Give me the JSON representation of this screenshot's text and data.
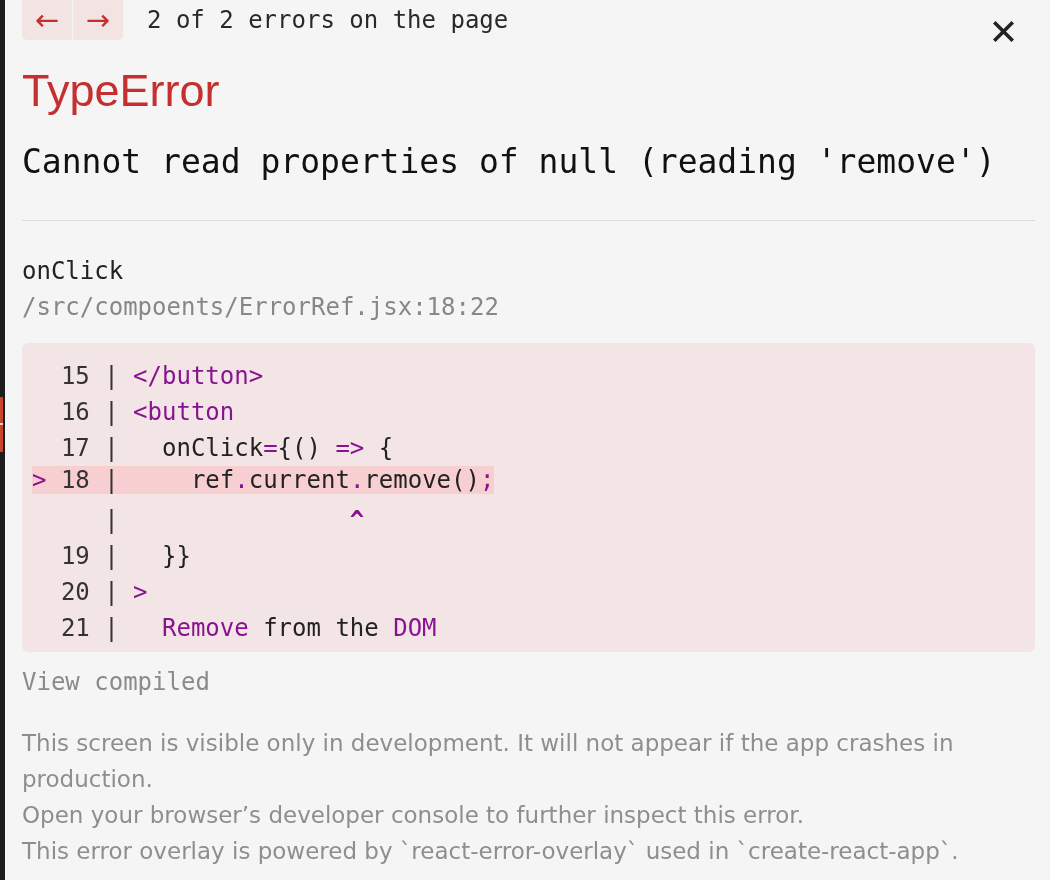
{
  "navigation": {
    "previous": "←",
    "next": "→",
    "counter": "2 of 2 errors on the page"
  },
  "error": {
    "type": "TypeError",
    "message": "Cannot read properties of null (reading 'remove')"
  },
  "stack_frame": {
    "function": "onClick",
    "location": "/src/compoents/ErrorRef.jsx:18:22"
  },
  "code_frame": {
    "lines": [
      {
        "kind": "source",
        "gutter": "15 |",
        "highlighted": false,
        "segments": [
          {
            "text": "</button>",
            "kind": "markup"
          }
        ]
      },
      {
        "kind": "source",
        "gutter": "16 |",
        "highlighted": false,
        "segments": [
          {
            "text": "<button",
            "kind": "markup"
          }
        ]
      },
      {
        "kind": "source",
        "gutter": "17 |",
        "highlighted": false,
        "segments": [
          {
            "text": "  onClick",
            "kind": "text"
          },
          {
            "text": "=",
            "kind": "markup"
          },
          {
            "text": "{() ",
            "kind": "text"
          },
          {
            "text": "=>",
            "kind": "markup"
          },
          {
            "text": " {",
            "kind": "text"
          }
        ]
      },
      {
        "kind": "source",
        "marker": ">",
        "gutter": "18 |",
        "highlighted": true,
        "segments": [
          {
            "text": "    ref",
            "kind": "text"
          },
          {
            "text": ".",
            "kind": "markup"
          },
          {
            "text": "current",
            "kind": "text"
          },
          {
            "text": ".",
            "kind": "markup"
          },
          {
            "text": "remove()",
            "kind": "text"
          },
          {
            "text": ";",
            "kind": "markup"
          }
        ]
      },
      {
        "kind": "pointer",
        "gutter": "|",
        "highlighted": false,
        "segments": [
          {
            "text": "               ^",
            "kind": "markup"
          }
        ]
      },
      {
        "kind": "source",
        "gutter": "19 |",
        "highlighted": false,
        "segments": [
          {
            "text": "  }}",
            "kind": "text"
          }
        ]
      },
      {
        "kind": "source",
        "gutter": "20 |",
        "highlighted": false,
        "segments": [
          {
            "text": ">",
            "kind": "markup"
          }
        ]
      },
      {
        "kind": "source",
        "gutter": "21 |",
        "highlighted": false,
        "segments": [
          {
            "text": "  Remove",
            "kind": "markup"
          },
          {
            "text": " from the ",
            "kind": "text"
          },
          {
            "text": "DOM",
            "kind": "markup"
          }
        ]
      }
    ]
  },
  "view_compiled": "View compiled",
  "footer": [
    "This screen is visible only in development. It will not appear if the app crashes in production.",
    "Open your browser’s developer console to further inspect this error.",
    "This error overlay is powered by `react-error-overlay` used in `create-react-app`."
  ]
}
